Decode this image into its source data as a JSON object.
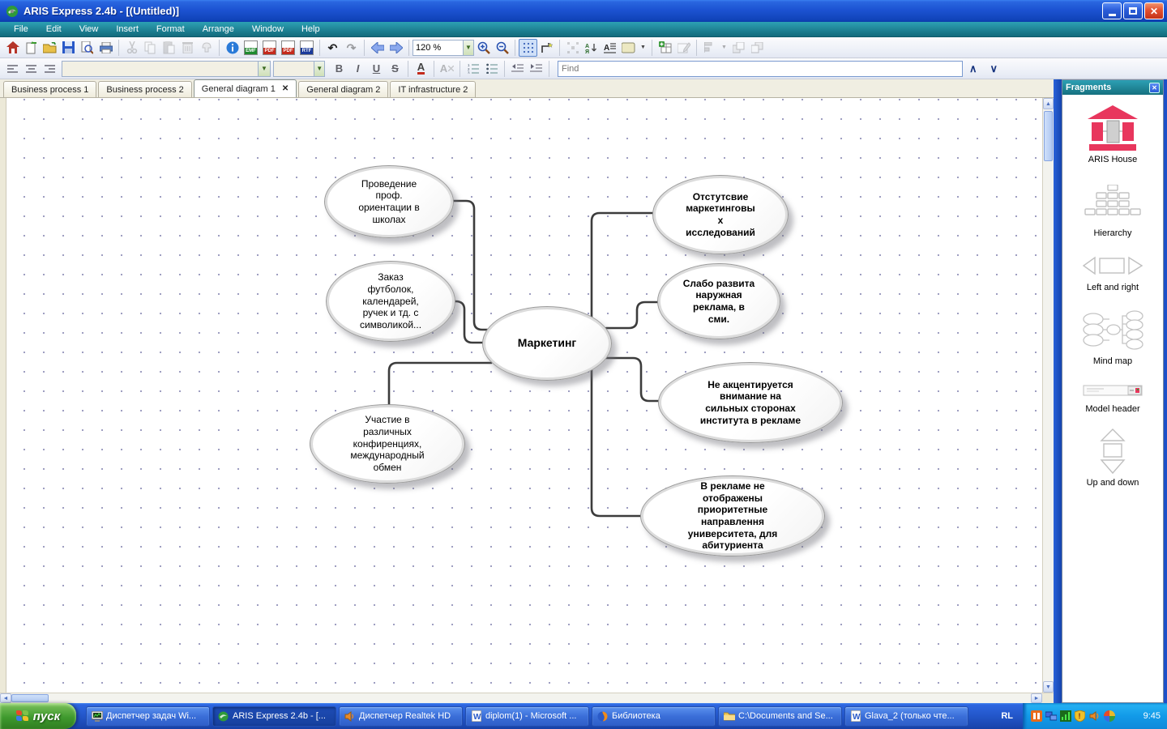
{
  "window": {
    "title": "ARIS Express 2.4b - [(Untitled)]"
  },
  "menu": {
    "items": [
      "File",
      "Edit",
      "View",
      "Insert",
      "Format",
      "Arrange",
      "Window",
      "Help"
    ]
  },
  "toolbar": {
    "zoom_value": "120 %",
    "export_badges": [
      "EMF",
      "PDF",
      "PDF",
      "RTF"
    ],
    "find_placeholder": "Find"
  },
  "format_bar": {
    "bold": "B",
    "italic": "I",
    "underline": "U",
    "strikethrough": "S",
    "font_color": "A",
    "clear_format": "A"
  },
  "tabs": {
    "items": [
      "Business process 1",
      "Business process 2",
      "General diagram 1",
      "General diagram 2",
      "IT infrastructure 2"
    ],
    "active": "General diagram 1"
  },
  "diagram": {
    "center_label": "Маркетинг",
    "nodes": [
      {
        "label": "Проведение\nпроф.\nориентации в\nшколах"
      },
      {
        "label": "Заказ\nфутболок,\nкалендарей,\nручек и тд. с\nсимволикой..."
      },
      {
        "label": "Участие в\nразличных\nконфиренциях,\nмеждународный\nобмен"
      },
      {
        "label": "Отстутсвие\nмаркетинговы\nх\nисследований"
      },
      {
        "label": "Слабо развита\nнаружная\nреклама, в\nсми."
      },
      {
        "label": "Не акцентируется\nвнимание на\nсильных сторонах\nинститута в рекламе"
      },
      {
        "label": "В рекламе не\nотображены\nприоритетные\nнаправлення\nуниверситета, для\nабитуриента"
      }
    ]
  },
  "fragments": {
    "title": "Fragments",
    "items": [
      "ARIS House",
      "Hierarchy",
      "Left and right",
      "Mind map",
      "Model header",
      "Up and down"
    ]
  },
  "taskbar": {
    "start_label": "пуск",
    "tasks": [
      "Диспетчер задач Wi...",
      "ARIS Express 2.4b - [...",
      "Диспетчер Realtek HD",
      "diplom(1) - Microsoft ...",
      "Библиотека",
      "C:\\Documents and Se...",
      "Glava_2 (только чте..."
    ],
    "language": "RL",
    "time": "9:45"
  },
  "icons": {
    "close": "✕",
    "undo": "↶",
    "redo": "↷",
    "dropdown": "▼",
    "chevron_up": "∧",
    "chevron_down": "∨",
    "scroll_up": "▲",
    "scroll_down": "▼",
    "scroll_left": "◄",
    "scroll_right": "►",
    "find_label": ""
  }
}
